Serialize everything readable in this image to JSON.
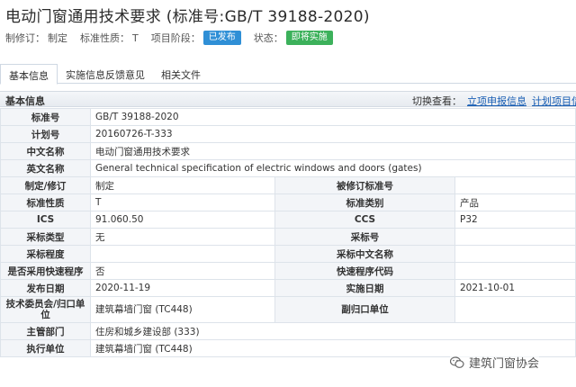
{
  "header": {
    "title": "电动门窗通用技术要求 (标准号:GB/T 39188-2020)",
    "meta": [
      {
        "key": "制修订：",
        "value": "制定"
      },
      {
        "key": "标准性质：",
        "value": "T"
      },
      {
        "key": "项目阶段：",
        "badge": "已发布",
        "badge_color": "#2f8fd6"
      },
      {
        "key": "状态：",
        "badge": "即将实施",
        "badge_color": "#3cb15b"
      }
    ]
  },
  "tabs": [
    {
      "label": "基本信息",
      "active": true
    },
    {
      "label": "实施信息反馈意见",
      "active": false
    },
    {
      "label": "相关文件",
      "active": false
    }
  ],
  "panel": {
    "label": "基本信息",
    "switch_label": "切换查看：",
    "switch_links": [
      "立项申报信息",
      "计划项目信息"
    ]
  },
  "rows": [
    {
      "k": "标准号",
      "v": "GB/T 39188-2020"
    },
    {
      "k": "计划号",
      "v": "20160726-T-333"
    },
    {
      "k": "中文名称",
      "v": "电动门窗通用技术要求"
    },
    {
      "k": "英文名称",
      "v": "General technical specification of electric windows and doors (gates)"
    },
    {
      "k": "制定/修订",
      "v": "制定",
      "k2": "被修订标准号",
      "v2": ""
    },
    {
      "k": "标准性质",
      "v": "T",
      "k2": "标准类别",
      "v2": "产品"
    },
    {
      "k": "ICS",
      "v": "91.060.50",
      "k2": "CCS",
      "v2": "P32"
    },
    {
      "k": "采标类型",
      "v": "无",
      "k2": "采标号",
      "v2": ""
    },
    {
      "k": "采标程度",
      "v": "",
      "k2": "采标中文名称",
      "v2": ""
    },
    {
      "k": "是否采用快速程序",
      "v": "否",
      "k2": "快速程序代码",
      "v2": ""
    },
    {
      "k": "发布日期",
      "v": "2020-11-19",
      "k2": "实施日期",
      "v2": "2021-10-01"
    },
    {
      "k": "技术委员会/归口单位",
      "v": "建筑幕墙门窗 (TC448)",
      "k2": "副归口单位",
      "v2": ""
    },
    {
      "k": "主管部门",
      "v": "住房和城乡建设部 (333)"
    },
    {
      "k": "执行单位",
      "v": "建筑幕墙门窗 (TC448)"
    }
  ],
  "watermark": {
    "text": "建筑门窗协会",
    "icon": "wechat-icon"
  }
}
